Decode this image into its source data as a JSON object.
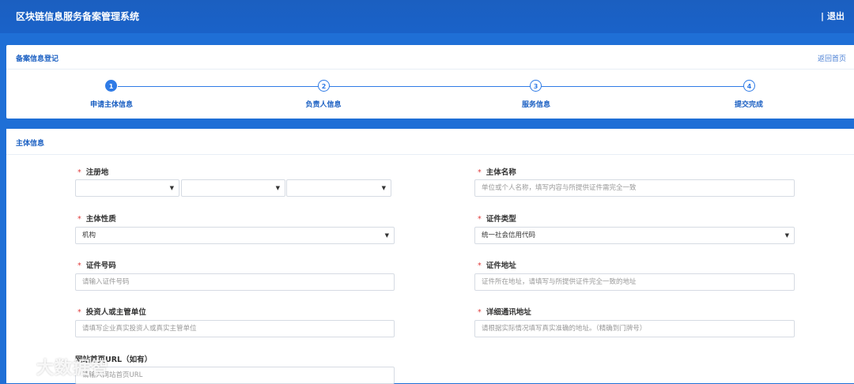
{
  "header": {
    "title": "区块链信息服务备案管理系统",
    "separator": "|",
    "logout": "退出"
  },
  "registration": {
    "title": "备案信息登记",
    "back_link": "返回首页",
    "steps": [
      {
        "number": "1",
        "label": "申请主体信息"
      },
      {
        "number": "2",
        "label": "负责人信息"
      },
      {
        "number": "3",
        "label": "服务信息"
      },
      {
        "number": "4",
        "label": "提交完成"
      }
    ]
  },
  "subject": {
    "title": "主体信息",
    "required_mark": "*",
    "fields": {
      "register_place": {
        "label": "注册地"
      },
      "subject_name": {
        "label": "主体名称",
        "placeholder": "单位或个人名称，填写内容与所提供证件需完全一致"
      },
      "subject_nature": {
        "label": "主体性质",
        "value": "机构"
      },
      "cert_type": {
        "label": "证件类型",
        "value": "统一社会信用代码"
      },
      "cert_number": {
        "label": "证件号码",
        "placeholder": "请输入证件号码"
      },
      "cert_address": {
        "label": "证件地址",
        "placeholder": "证件所在地址，请填写与所提供证件完全一致的地址"
      },
      "investor": {
        "label": "投资人或主管单位",
        "placeholder": "请填写企业真实投资人或真实主管单位"
      },
      "mail_address": {
        "label": "详细通讯地址",
        "placeholder": "请根据实际情况填写真实准确的地址。（精确到门牌号）"
      },
      "website_url": {
        "label": "网站首页URL（如有）",
        "placeholder": "请输入网站首页URL"
      }
    }
  },
  "watermark": {
    "text": "大数据智"
  },
  "colors": {
    "primary": "#1f6fd6",
    "accent": "#2f7be6",
    "required": "#e03a3a"
  }
}
